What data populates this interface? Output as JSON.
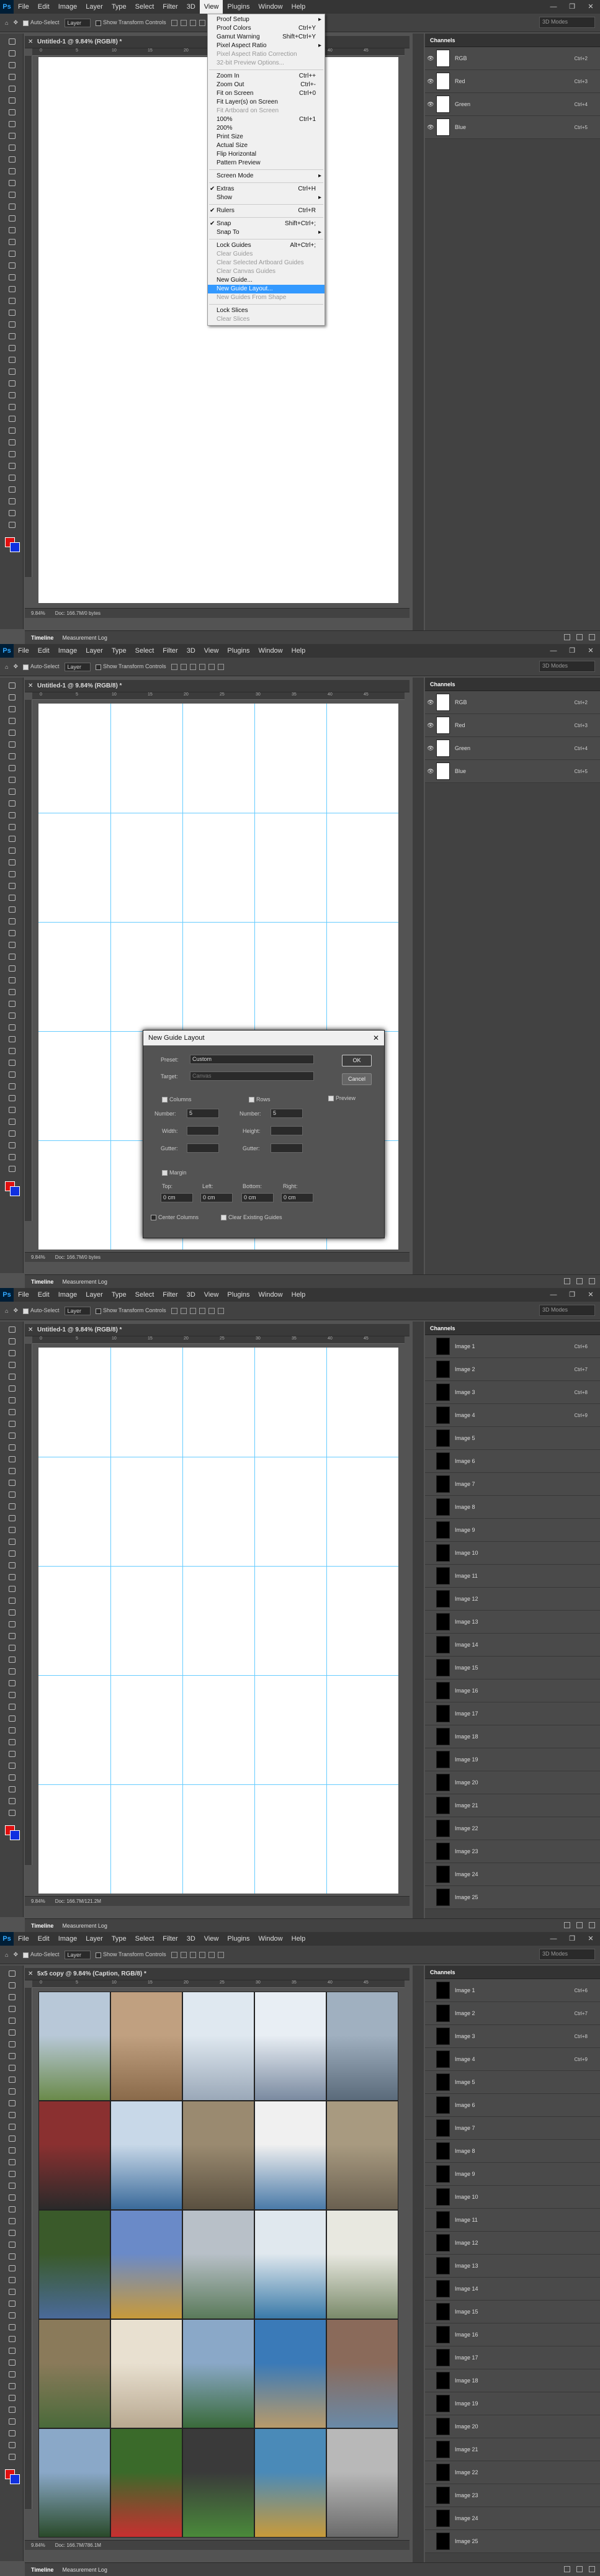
{
  "app": {
    "logo": "Ps",
    "menus": [
      "File",
      "Edit",
      "Image",
      "Layer",
      "Type",
      "Select",
      "Filter",
      "3D",
      "View",
      "Plugins",
      "Window",
      "Help"
    ],
    "window_controls": [
      "—",
      "❐",
      "✕"
    ]
  },
  "options": {
    "auto_select": "Auto-Select",
    "layer_select": "Layer",
    "show_transform": "Show Transform Controls",
    "mode_3d": "3D Mode:",
    "search_placeholder": "3D Modes"
  },
  "frames": [
    {
      "doc_title": "Untitled-1 @ 9.84% (RGB/8) *",
      "zoom": "9.84%",
      "doc_info": "Doc: 166.7M/0 bytes"
    },
    {
      "doc_title": "Untitled-1 @ 9.84% (RGB/8) *",
      "zoom": "9.84%",
      "doc_info": "Doc: 166.7M/0 bytes"
    },
    {
      "doc_title": "Untitled-1 @ 9.84% (RGB/8) *",
      "zoom": "9.84%",
      "doc_info": "Doc: 166.7M/121.2M"
    },
    {
      "doc_title": "5x5 copy @ 9.84% (Caption, RGB/8) *",
      "zoom": "9.84%",
      "doc_info": "Doc: 166.7M/786.1M"
    }
  ],
  "ruler_numbers": [
    "0",
    "5",
    "10",
    "15",
    "20",
    "25",
    "30",
    "35",
    "40",
    "45"
  ],
  "timeline": {
    "tab1": "Timeline",
    "tab2": "Measurement Log"
  },
  "channels_panel": {
    "title": "Channels",
    "rgb": [
      {
        "name": "RGB",
        "shortcut": "Ctrl+2"
      },
      {
        "name": "Red",
        "shortcut": "Ctrl+3"
      },
      {
        "name": "Green",
        "shortcut": "Ctrl+4"
      },
      {
        "name": "Blue",
        "shortcut": "Ctrl+5"
      }
    ],
    "images": [
      {
        "name": "Image 1",
        "shortcut": "Ctrl+6"
      },
      {
        "name": "Image 2",
        "shortcut": "Ctrl+7"
      },
      {
        "name": "Image 3",
        "shortcut": "Ctrl+8"
      },
      {
        "name": "Image 4",
        "shortcut": "Ctrl+9"
      },
      {
        "name": "Image 5",
        "shortcut": ""
      },
      {
        "name": "Image 6",
        "shortcut": ""
      },
      {
        "name": "Image 7",
        "shortcut": ""
      },
      {
        "name": "Image 8",
        "shortcut": ""
      },
      {
        "name": "Image 9",
        "shortcut": ""
      },
      {
        "name": "Image 10",
        "shortcut": ""
      },
      {
        "name": "Image 11",
        "shortcut": ""
      },
      {
        "name": "Image 12",
        "shortcut": ""
      },
      {
        "name": "Image 13",
        "shortcut": ""
      },
      {
        "name": "Image 14",
        "shortcut": ""
      },
      {
        "name": "Image 15",
        "shortcut": ""
      },
      {
        "name": "Image 16",
        "shortcut": ""
      },
      {
        "name": "Image 17",
        "shortcut": ""
      },
      {
        "name": "Image 18",
        "shortcut": ""
      },
      {
        "name": "Image 19",
        "shortcut": ""
      },
      {
        "name": "Image 20",
        "shortcut": ""
      },
      {
        "name": "Image 21",
        "shortcut": ""
      },
      {
        "name": "Image 22",
        "shortcut": ""
      },
      {
        "name": "Image 23",
        "shortcut": ""
      },
      {
        "name": "Image 24",
        "shortcut": ""
      },
      {
        "name": "Image 25",
        "shortcut": ""
      }
    ]
  },
  "view_menu": [
    {
      "label": "Proof Setup",
      "sc": "",
      "arrow": true
    },
    {
      "label": "Proof Colors",
      "sc": "Ctrl+Y"
    },
    {
      "label": "Gamut Warning",
      "sc": "Shift+Ctrl+Y"
    },
    {
      "label": "Pixel Aspect Ratio",
      "sc": "",
      "arrow": true
    },
    {
      "label": "Pixel Aspect Ratio Correction",
      "sc": "",
      "disabled": true
    },
    {
      "label": "32-bit Preview Options...",
      "sc": "",
      "disabled": true
    },
    {
      "sep": true
    },
    {
      "label": "Zoom In",
      "sc": "Ctrl++"
    },
    {
      "label": "Zoom Out",
      "sc": "Ctrl+-"
    },
    {
      "label": "Fit on Screen",
      "sc": "Ctrl+0"
    },
    {
      "label": "Fit Layer(s) on Screen",
      "sc": ""
    },
    {
      "label": "Fit Artboard on Screen",
      "sc": "",
      "disabled": true
    },
    {
      "label": "100%",
      "sc": "Ctrl+1"
    },
    {
      "label": "200%",
      "sc": ""
    },
    {
      "label": "Print Size",
      "sc": ""
    },
    {
      "label": "Actual Size",
      "sc": ""
    },
    {
      "label": "Flip Horizontal",
      "sc": ""
    },
    {
      "label": "Pattern Preview",
      "sc": ""
    },
    {
      "sep": true
    },
    {
      "label": "Screen Mode",
      "sc": "",
      "arrow": true
    },
    {
      "sep": true
    },
    {
      "label": "Extras",
      "sc": "Ctrl+H",
      "check": true
    },
    {
      "label": "Show",
      "sc": "",
      "arrow": true
    },
    {
      "sep": true
    },
    {
      "label": "Rulers",
      "sc": "Ctrl+R",
      "check": true
    },
    {
      "sep": true
    },
    {
      "label": "Snap",
      "sc": "Shift+Ctrl+;",
      "check": true
    },
    {
      "label": "Snap To",
      "sc": "",
      "arrow": true
    },
    {
      "sep": true
    },
    {
      "label": "Lock Guides",
      "sc": "Alt+Ctrl+;"
    },
    {
      "label": "Clear Guides",
      "sc": "",
      "disabled": true
    },
    {
      "label": "Clear Selected Artboard Guides",
      "sc": "",
      "disabled": true
    },
    {
      "label": "Clear Canvas Guides",
      "sc": "",
      "disabled": true
    },
    {
      "label": "New Guide...",
      "sc": ""
    },
    {
      "label": "New Guide Layout...",
      "sc": "",
      "highlight": true
    },
    {
      "label": "New Guides From Shape",
      "sc": "",
      "disabled": true
    },
    {
      "sep": true
    },
    {
      "label": "Lock Slices",
      "sc": ""
    },
    {
      "label": "Clear Slices",
      "sc": "",
      "disabled": true
    }
  ],
  "dialog": {
    "title": "New Guide Layout",
    "close": "✕",
    "preset_label": "Preset:",
    "preset_value": "Custom",
    "target_label": "Target:",
    "target_value": "Canvas",
    "columns_label": "Columns",
    "rows_label": "Rows",
    "number_label": "Number:",
    "col_number": "5",
    "row_number": "5",
    "width_label": "Width:",
    "height_label": "Height:",
    "gutter_label": "Gutter:",
    "margin_label": "Margin",
    "top_label": "Top:",
    "left_label": "Left:",
    "bottom_label": "Bottom:",
    "right_label": "Right:",
    "top_value": "0 cm",
    "left_value": "0 cm",
    "bottom_value": "0 cm",
    "right_value": "0 cm",
    "center_columns": "Center Columns",
    "clear_existing": "Clear Existing Guides",
    "ok": "OK",
    "cancel": "Cancel",
    "preview": "Preview"
  },
  "colors": {
    "guide": "#66ccff",
    "highlight": "#3399ff",
    "fg": "#e01010",
    "bg": "#1030e0"
  }
}
